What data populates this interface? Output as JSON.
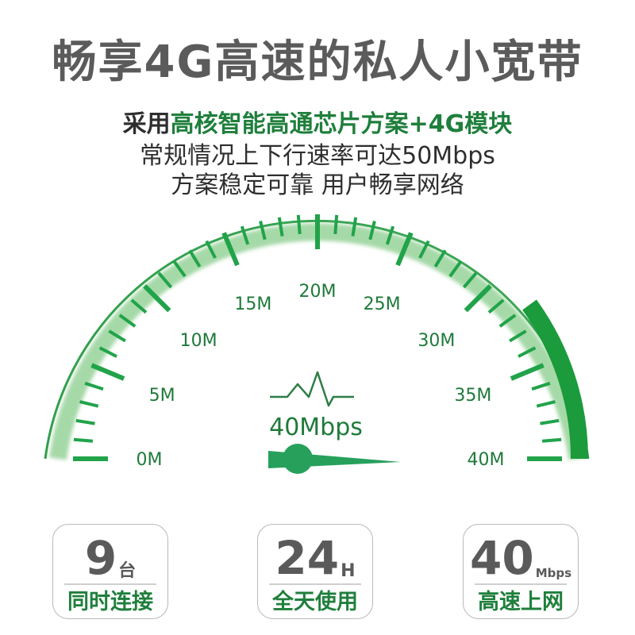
{
  "headline": "畅享4G高速的私人小宽带",
  "subtitle": {
    "line1_prefix": "采用",
    "line1_highlight": "高核智能高通芯片方案+4G模块",
    "line2": "常规情况上下行速率可达50Mbps",
    "line3": "方案稳定可靠 用户畅享网络"
  },
  "gauge": {
    "scale_labels": [
      "0M",
      "5M",
      "10M",
      "15M",
      "20M",
      "25M",
      "30M",
      "35M",
      "40M"
    ],
    "readout": "40Mbps",
    "max_value": 40,
    "needle_value": 40,
    "colors": {
      "light_green": "#a6d9a8",
      "dark_green": "#1b9b3b",
      "tick": "#21a34a",
      "text": "#1f7a3a",
      "pivot": "#27a05c"
    }
  },
  "cards": [
    {
      "number": "9",
      "unit": "台",
      "caption": "同时连接"
    },
    {
      "number": "24",
      "unit": "H",
      "caption": "全天使用"
    },
    {
      "number": "40",
      "unit": "Mbps",
      "caption": "高速上网"
    }
  ]
}
